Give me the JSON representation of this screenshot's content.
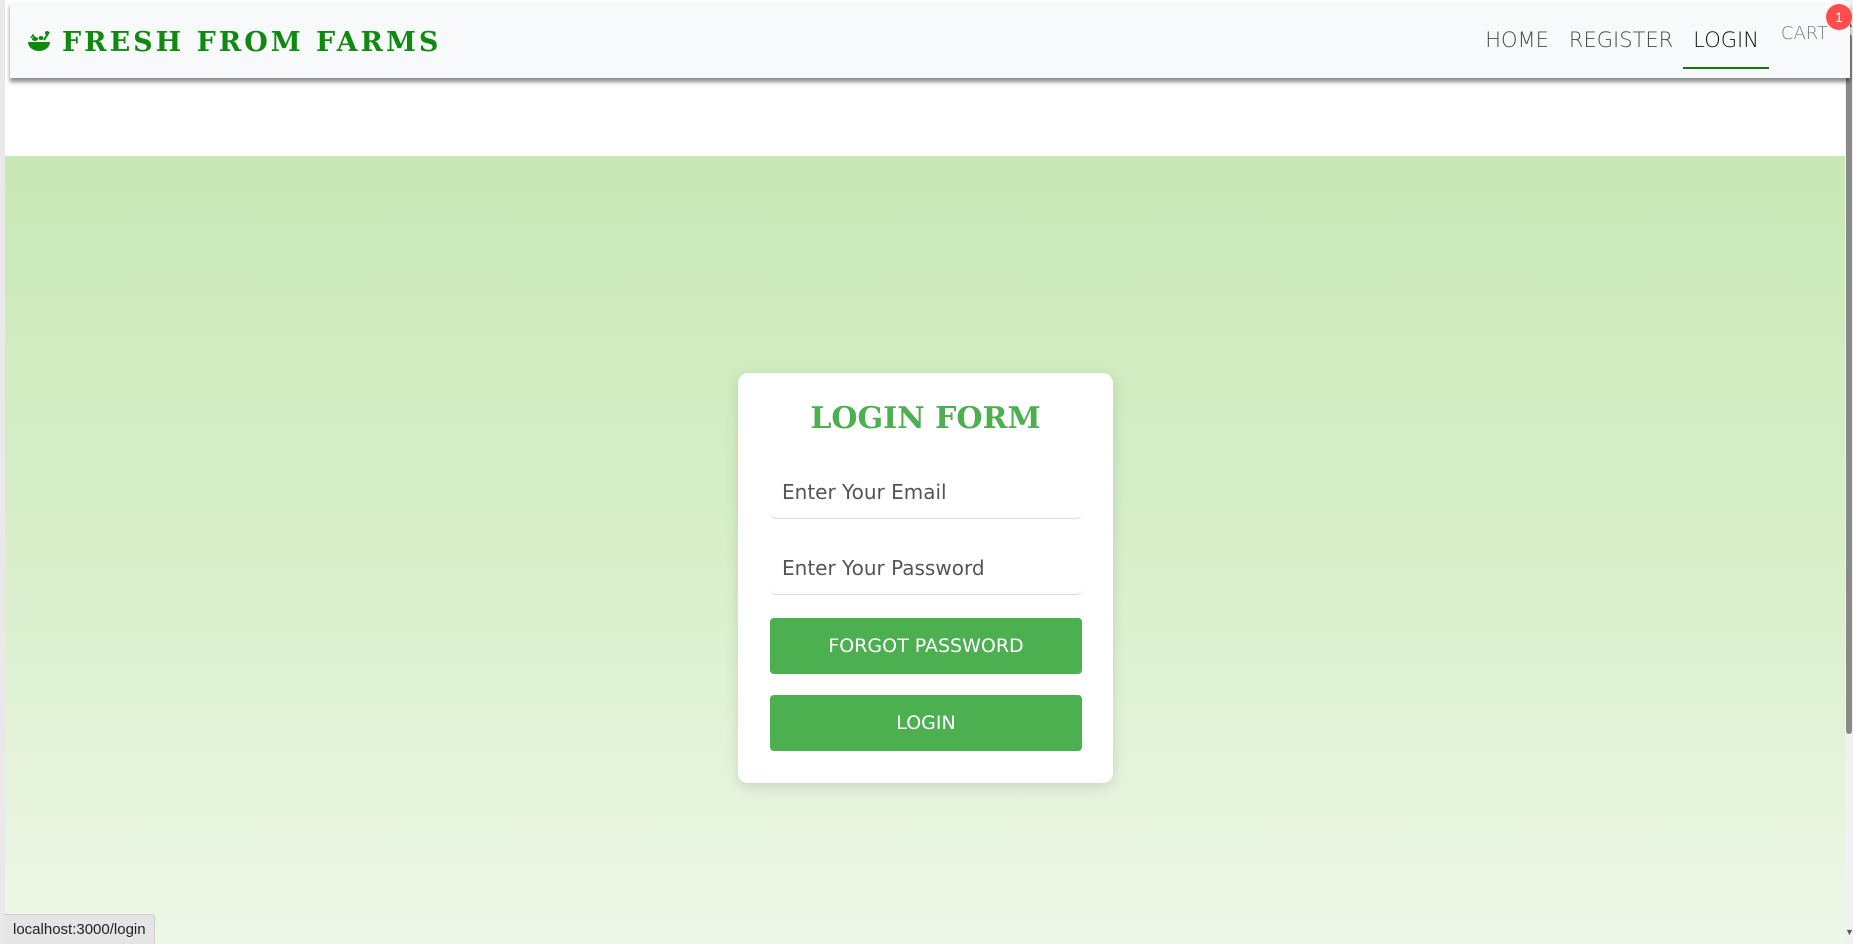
{
  "brand": {
    "name": "FRESH FROM FARMS",
    "icon": "salad-bowl-icon"
  },
  "nav": {
    "links": [
      {
        "label": "HOME",
        "active": false
      },
      {
        "label": "REGISTER",
        "active": false
      },
      {
        "label": "LOGIN",
        "active": true
      }
    ],
    "cart": {
      "label": "CART",
      "count": "1"
    }
  },
  "form": {
    "title": "LOGIN FORM",
    "email_placeholder": "Enter Your Email",
    "password_placeholder": "Enter Your Password",
    "forgot_label": "FORGOT PASSWORD",
    "login_label": "LOGIN"
  },
  "status": {
    "url": "localhost:3000/login"
  },
  "colors": {
    "brand": "#0f8a0f",
    "accent": "#4caf50",
    "badge": "#ff4d4f",
    "hero_top": "#c8e8b6",
    "hero_bottom": "#eef7e8"
  }
}
